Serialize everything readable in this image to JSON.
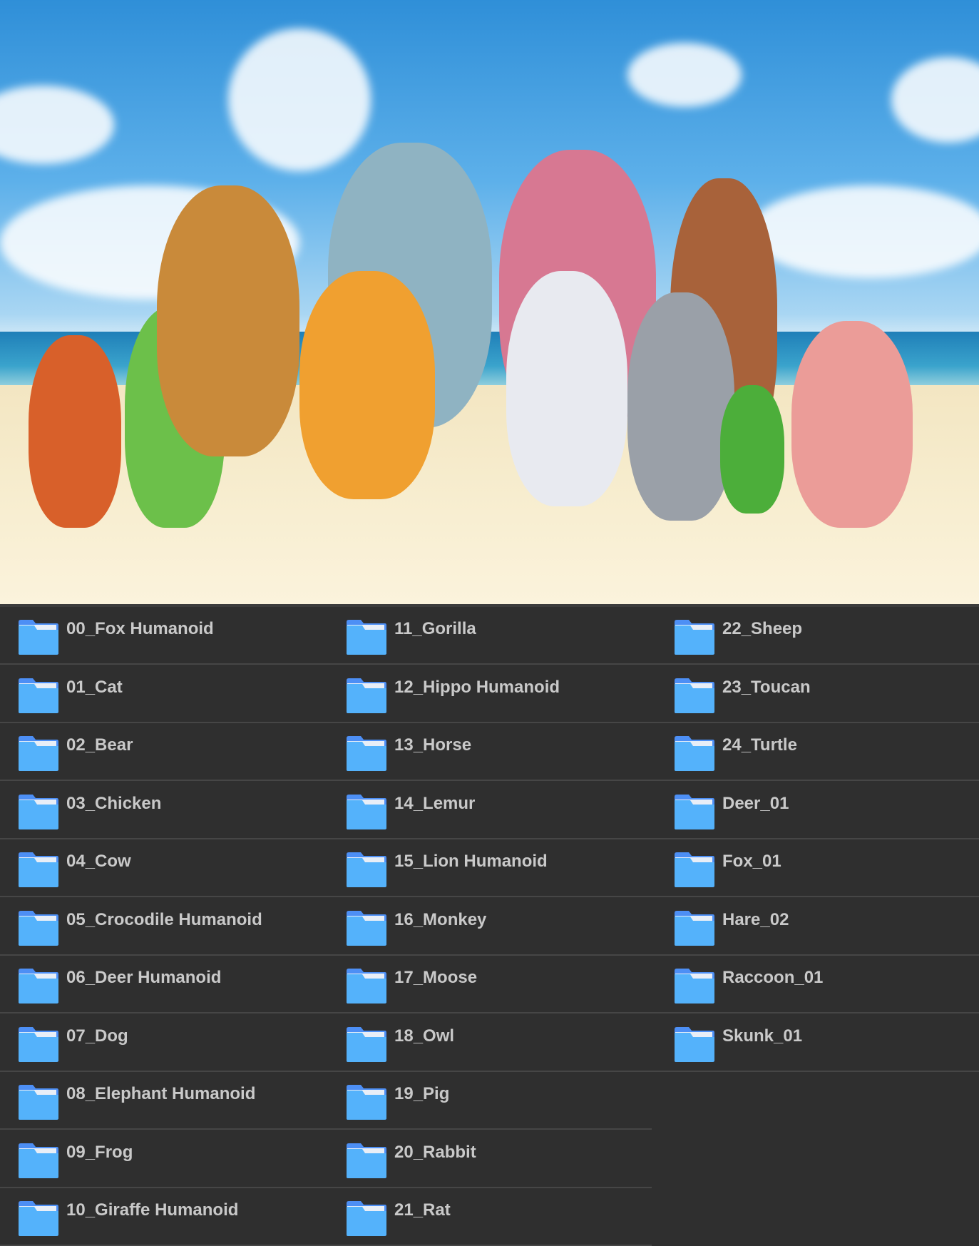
{
  "colors": {
    "background": "#2f2f2f",
    "folder": "#54b2fb",
    "folder_tab": "#4d8ff5",
    "label": "#c9c9c9"
  },
  "folder_icon": "folder-icon",
  "columns": [
    [
      "00_Fox Humanoid",
      "01_Cat",
      "02_Bear",
      "03_Chicken",
      "04_Cow",
      "05_Crocodile Humanoid",
      "06_Deer Humanoid",
      "07_Dog",
      "08_Elephant Humanoid",
      "09_Frog",
      "10_Giraffe Humanoid"
    ],
    [
      "11_Gorilla",
      "12_Hippo Humanoid",
      "13_Horse",
      "14_Lemur",
      "15_Lion Humanoid",
      "16_Monkey",
      "17_Moose",
      "18_Owl",
      "19_Pig",
      "20_Rabbit",
      "21_Rat"
    ],
    [
      "22_Sheep",
      "23_Toucan",
      "24_Turtle",
      "Deer_01",
      "Fox_01",
      "Hare_02",
      "Raccoon_01",
      "Skunk_01"
    ]
  ]
}
